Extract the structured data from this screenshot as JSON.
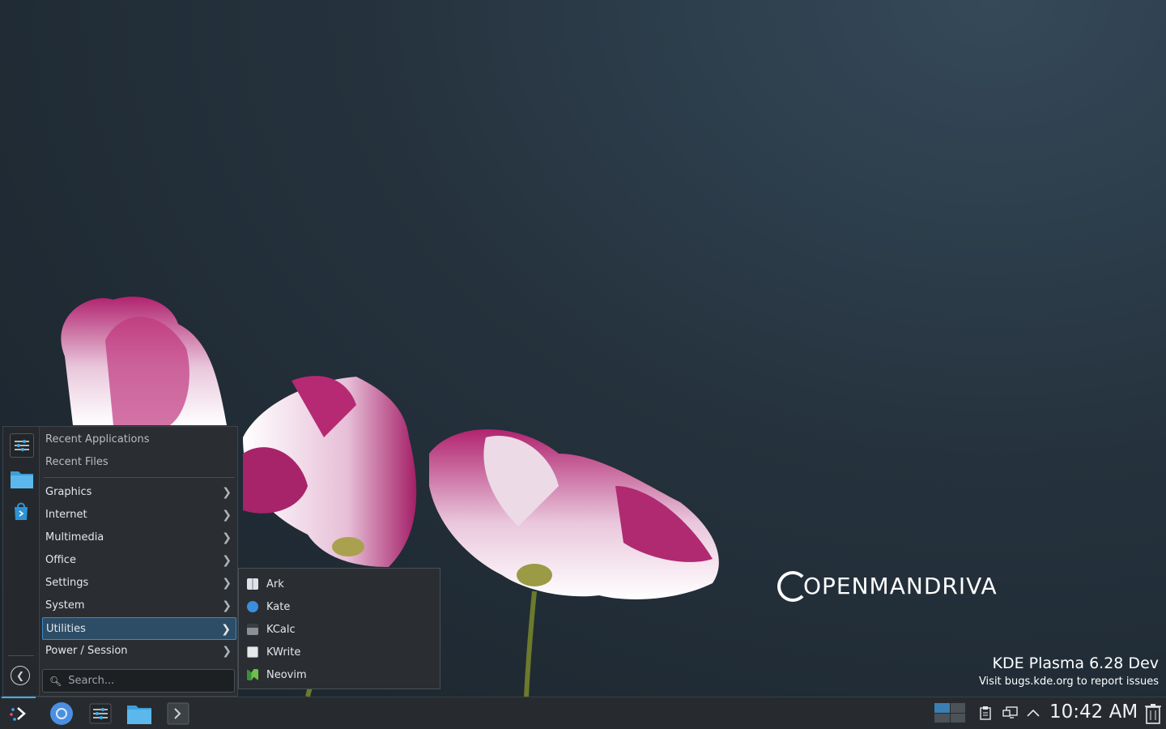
{
  "desktop": {
    "logo_text": "OpenMandriva",
    "watermark_title": "KDE Plasma 6.28 Dev",
    "watermark_subtitle": "Visit bugs.kde.org to report issues"
  },
  "launcher": {
    "favorites": [
      {
        "name": "system-settings-icon"
      },
      {
        "name": "file-manager-icon"
      },
      {
        "name": "discover-store-icon"
      }
    ],
    "categories_top": [
      {
        "label": "Recent Applications"
      },
      {
        "label": "Recent Files"
      }
    ],
    "categories": [
      {
        "label": "Graphics"
      },
      {
        "label": "Internet"
      },
      {
        "label": "Multimedia"
      },
      {
        "label": "Office"
      },
      {
        "label": "Settings"
      },
      {
        "label": "System"
      },
      {
        "label": "Utilities",
        "selected": true
      },
      {
        "label": "Power / Session"
      }
    ],
    "search_placeholder": "Search..."
  },
  "submenu": {
    "items": [
      {
        "label": "Ark",
        "icon": "ark-icon"
      },
      {
        "label": "Kate",
        "icon": "kate-icon"
      },
      {
        "label": "KCalc",
        "icon": "kcalc-icon"
      },
      {
        "label": "KWrite",
        "icon": "kwrite-icon"
      },
      {
        "label": "Neovim",
        "icon": "neovim-icon"
      }
    ]
  },
  "taskbar": {
    "clock": "10:42 AM"
  },
  "colors": {
    "accent": "#3daee9",
    "selection_bg": "#2d4d67",
    "panel_bg": "#2a2e32"
  }
}
